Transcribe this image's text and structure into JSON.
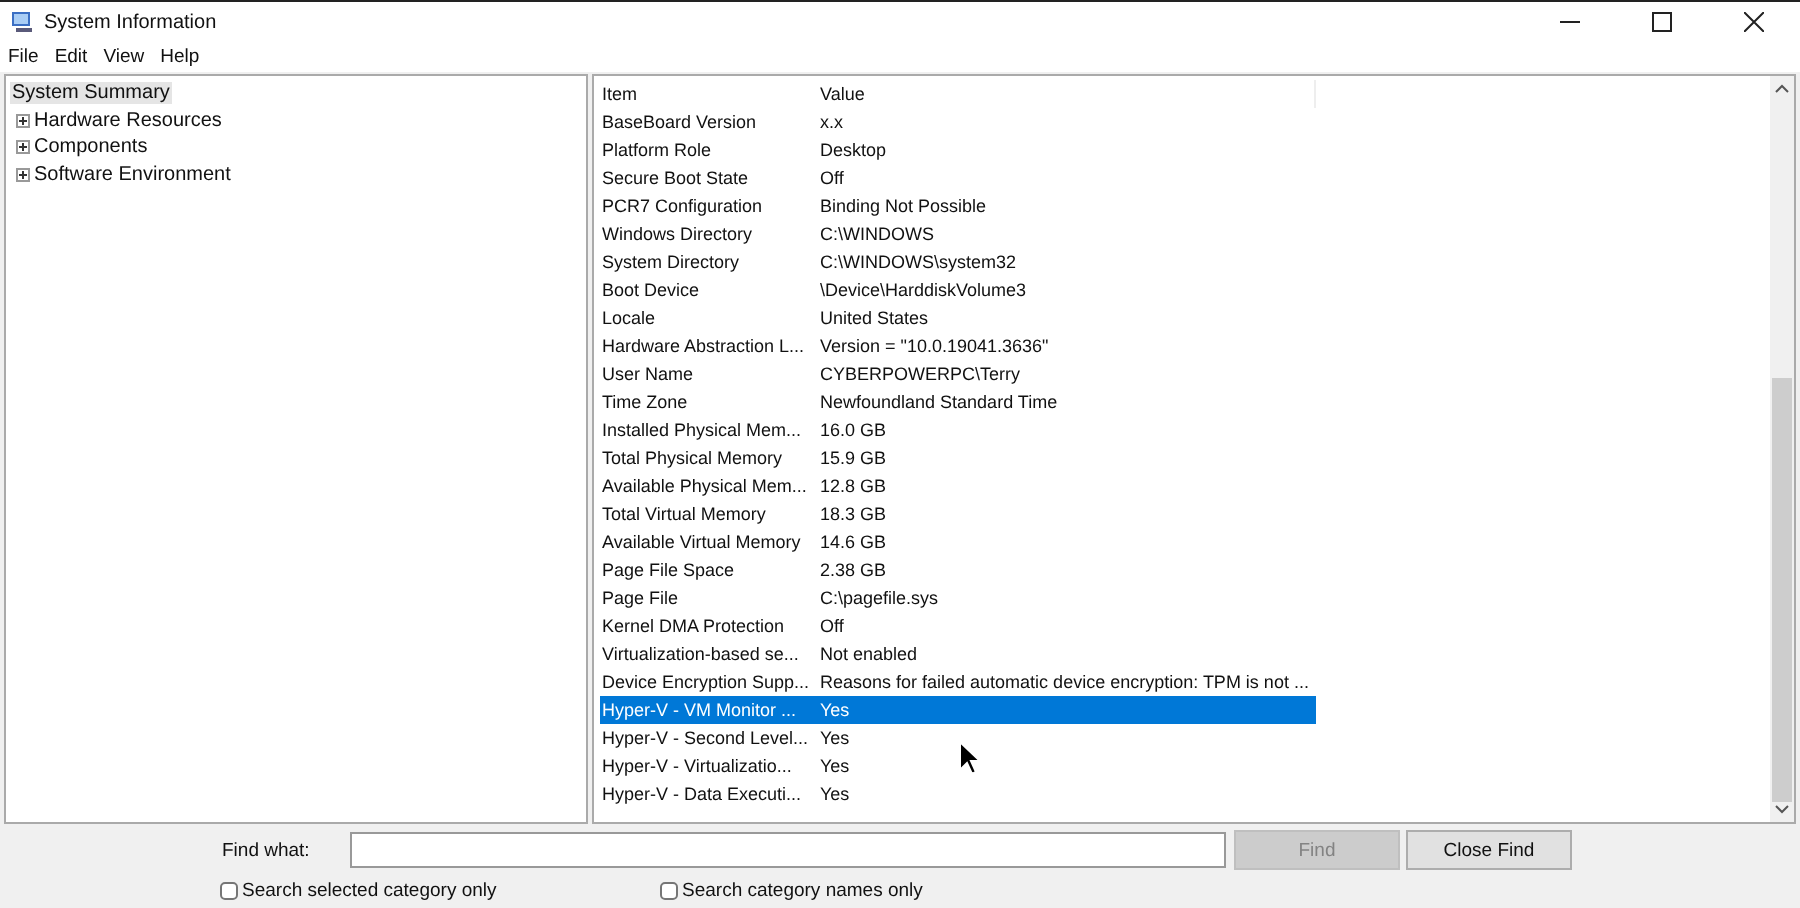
{
  "window": {
    "title": "System Information"
  },
  "menu": [
    "File",
    "Edit",
    "View",
    "Help"
  ],
  "tree": [
    {
      "label": "System Summary",
      "selected": true
    },
    {
      "label": "Hardware Resources",
      "selected": false,
      "expanded": false
    },
    {
      "label": "Components",
      "selected": false,
      "expanded": false
    },
    {
      "label": "Software Environment",
      "selected": false,
      "expanded": false
    }
  ],
  "table": {
    "columns": [
      "Item",
      "Value"
    ],
    "rows": [
      {
        "item": "BaseBoard Version",
        "value": "x.x",
        "selected": false
      },
      {
        "item": "Platform Role",
        "value": "Desktop",
        "selected": false
      },
      {
        "item": "Secure Boot State",
        "value": "Off",
        "selected": false
      },
      {
        "item": "PCR7 Configuration",
        "value": "Binding Not Possible",
        "selected": false
      },
      {
        "item": "Windows Directory",
        "value": "C:\\WINDOWS",
        "selected": false
      },
      {
        "item": "System Directory",
        "value": "C:\\WINDOWS\\system32",
        "selected": false
      },
      {
        "item": "Boot Device",
        "value": "\\Device\\HarddiskVolume3",
        "selected": false
      },
      {
        "item": "Locale",
        "value": "United States",
        "selected": false
      },
      {
        "item": "Hardware Abstraction L...",
        "value": "Version = \"10.0.19041.3636\"",
        "selected": false
      },
      {
        "item": "User Name",
        "value": "CYBERPOWERPC\\Terry",
        "selected": false
      },
      {
        "item": "Time Zone",
        "value": "Newfoundland Standard Time",
        "selected": false
      },
      {
        "item": "Installed Physical Mem...",
        "value": "16.0 GB",
        "selected": false
      },
      {
        "item": "Total Physical Memory",
        "value": "15.9 GB",
        "selected": false
      },
      {
        "item": "Available Physical Mem...",
        "value": "12.8 GB",
        "selected": false
      },
      {
        "item": "Total Virtual Memory",
        "value": "18.3 GB",
        "selected": false
      },
      {
        "item": "Available Virtual Memory",
        "value": "14.6 GB",
        "selected": false
      },
      {
        "item": "Page File Space",
        "value": "2.38 GB",
        "selected": false
      },
      {
        "item": "Page File",
        "value": "C:\\pagefile.sys",
        "selected": false
      },
      {
        "item": "Kernel DMA Protection",
        "value": "Off",
        "selected": false
      },
      {
        "item": "Virtualization-based se...",
        "value": "Not enabled",
        "selected": false
      },
      {
        "item": "Device Encryption Supp...",
        "value": "Reasons for failed automatic device encryption: TPM is not ...",
        "selected": false
      },
      {
        "item": "Hyper-V - VM Monitor ...",
        "value": "Yes",
        "selected": true
      },
      {
        "item": "Hyper-V - Second Level...",
        "value": "Yes",
        "selected": false
      },
      {
        "item": "Hyper-V - Virtualizatio...",
        "value": "Yes",
        "selected": false
      },
      {
        "item": "Hyper-V - Data Executi...",
        "value": "Yes",
        "selected": false
      }
    ]
  },
  "find": {
    "label": "Find what:",
    "find_button": {
      "label": "Find",
      "disabled": true
    },
    "close_button": {
      "label": "Close Find",
      "disabled": false
    },
    "options": [
      {
        "label": "Search selected category only",
        "checked": false
      },
      {
        "label": "Search category names only",
        "checked": false
      }
    ]
  }
}
